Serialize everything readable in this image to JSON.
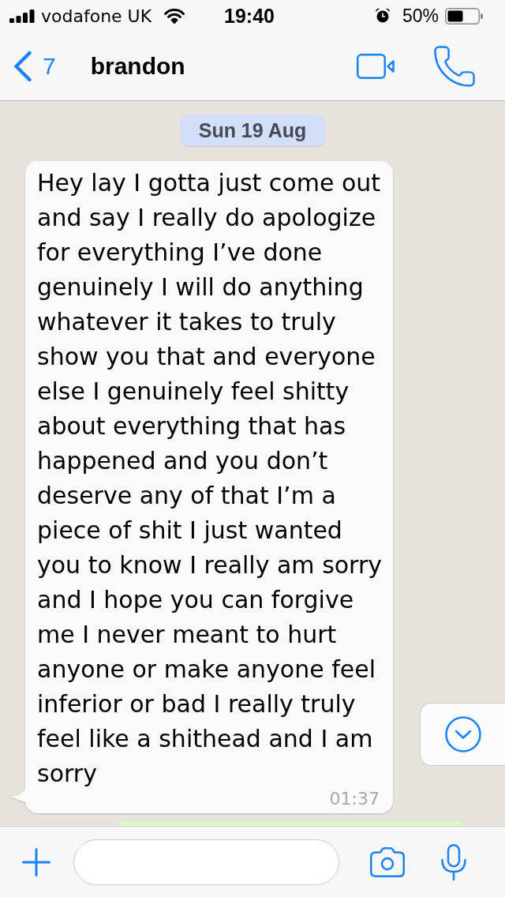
{
  "status_bar": {
    "carrier": "vodafone UK",
    "time": "19:40",
    "battery": "50%"
  },
  "header": {
    "back_count": "7",
    "title": "brandon"
  },
  "chat": {
    "date_label": "Sun 19 Aug",
    "messages": [
      {
        "kind": "incoming",
        "text": "Hey lay I gotta just come out and say I really do apologize for everything I’ve done genuinely I will do anything whatever it takes to truly show you that and everyone else I genuinely feel shitty about everything that has happened and you don’t deserve any of that I’m a piece of shit I just wanted you to know I really am sorry and I hope you can forgive me I never meant to hurt anyone or make anyone feel inferior or bad I really truly feel like a shithead and I am sorry",
        "time": "01:37"
      },
      {
        "kind": "outgoing"
      }
    ]
  }
}
